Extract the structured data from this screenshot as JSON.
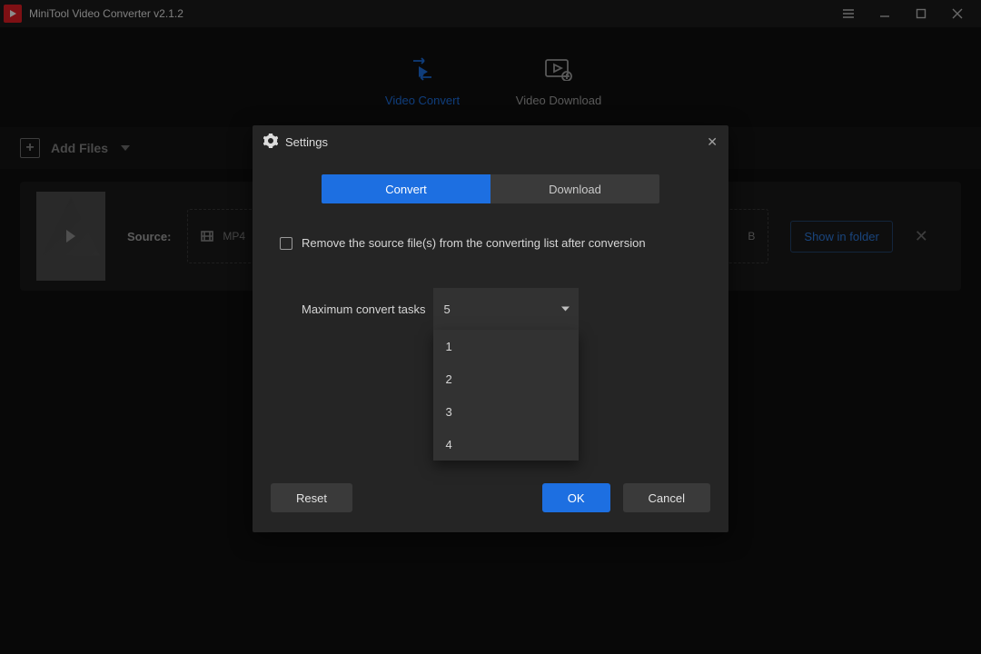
{
  "title": "MiniTool Video Converter v2.1.2",
  "tabs": {
    "convert": "Video Convert",
    "download": "Video Download"
  },
  "toolbar": {
    "add_files": "Add Files"
  },
  "row": {
    "source_label": "Source:",
    "format": "MP4",
    "size": "B",
    "show_folder": "Show in folder"
  },
  "settings": {
    "title": "Settings",
    "seg": {
      "convert": "Convert",
      "download": "Download"
    },
    "remove_src": "Remove the source file(s) from the converting list after conversion",
    "max_label": "Maximum convert tasks",
    "max_current": "5",
    "options": [
      "1",
      "2",
      "3",
      "4"
    ],
    "reset": "Reset",
    "ok": "OK",
    "cancel": "Cancel"
  }
}
